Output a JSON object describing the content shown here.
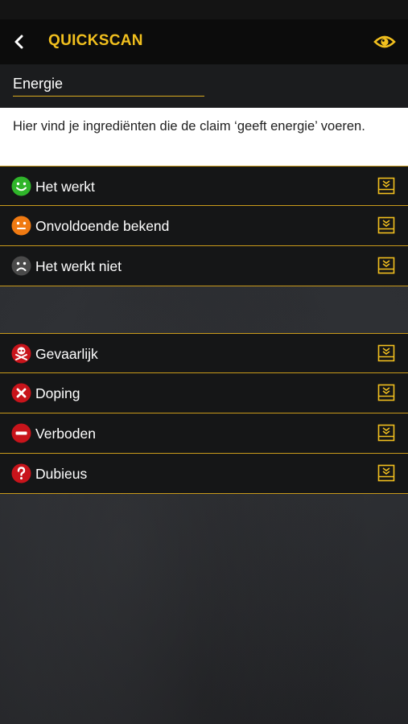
{
  "header": {
    "title": "QUICKSCAN",
    "back_icon": "chevron-left-icon",
    "eye_icon": "eye-icon"
  },
  "claim": {
    "value": "Energie"
  },
  "info": {
    "text": "Hier vind je ingrediënten die de claim ‘geeft energie’ voeren."
  },
  "effect_list": [
    {
      "label": "Het werkt",
      "icon": "smiley-happy-icon",
      "color": "#2fb52a"
    },
    {
      "label": "Onvoldoende bekend",
      "icon": "smiley-neutral-icon",
      "color": "#f07a12"
    },
    {
      "label": "Het werkt niet",
      "icon": "smiley-sad-icon",
      "color": "#4a4a4a"
    }
  ],
  "risk_list": [
    {
      "label": "Gevaarlijk",
      "icon": "skull-icon",
      "color": "#c8141b"
    },
    {
      "label": "Doping",
      "icon": "cross-icon",
      "color": "#c8141b"
    },
    {
      "label": "Verboden",
      "icon": "no-entry-icon",
      "color": "#c8141b"
    },
    {
      "label": "Dubieus",
      "icon": "question-icon",
      "color": "#c8141b"
    }
  ],
  "colors": {
    "accent": "#f2c01e",
    "divider": "#c99a1b"
  }
}
